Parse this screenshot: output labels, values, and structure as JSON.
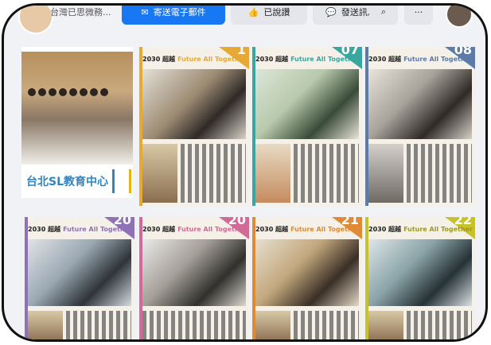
{
  "topbar": {
    "page_name": "台灣已思微務...",
    "primary_button": "寄送電子郵件",
    "follow_button": "已說讚",
    "message_button": "發送訊息",
    "search_icon": "search-icon",
    "more_icon": "more-icon"
  },
  "photo_card": {
    "banner_text": "台北SL教育中心"
  },
  "posters": [
    {
      "title_cn": "2030 超越",
      "title_en": "Future All Together",
      "number": "1",
      "accent": "#e6a935"
    },
    {
      "title_cn": "2030 超越",
      "title_en": "Future All Together",
      "number": "07",
      "accent": "#3aa6a0"
    },
    {
      "title_cn": "2030 超越",
      "title_en": "Future All Together",
      "number": "08",
      "accent": "#5d7ba8"
    },
    {
      "title_cn": "2030 超越",
      "title_en": "Future All Together",
      "number": "20",
      "accent": "#8e72b5"
    },
    {
      "title_cn": "2030 超越",
      "title_en": "Future All Together",
      "number": "20",
      "accent": "#d16a96"
    },
    {
      "title_cn": "2030 超越",
      "title_en": "Future All Together",
      "number": "21",
      "accent": "#e08a33"
    },
    {
      "title_cn": "2030 超越",
      "title_en": "Future All Together",
      "number": "22",
      "accent": "#c7c12a"
    }
  ]
}
